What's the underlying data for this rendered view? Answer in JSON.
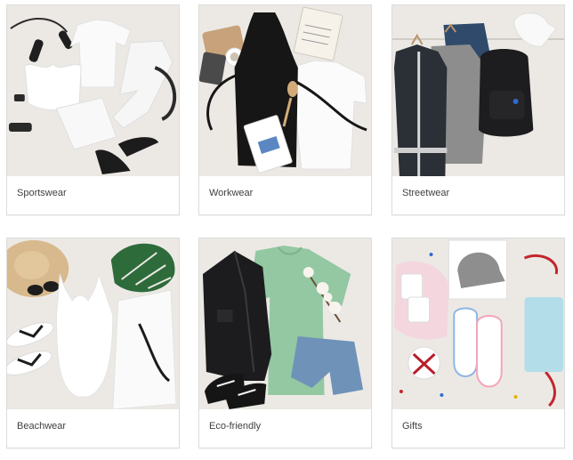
{
  "section": {
    "title": ""
  },
  "categories": [
    {
      "label": "Sportswear",
      "image": "sportswear-flatlay-image"
    },
    {
      "label": "Workwear",
      "image": "workwear-flatlay-image"
    },
    {
      "label": "Streetwear",
      "image": "streetwear-flatlay-image"
    },
    {
      "label": "Beachwear",
      "image": "beachwear-flatlay-image"
    },
    {
      "label": "Eco-friendly",
      "image": "eco-friendly-flatlay-image"
    },
    {
      "label": "Gifts",
      "image": "gifts-flatlay-image"
    }
  ],
  "colors": {
    "photo_background": "#ece9e5",
    "card_border": "#dcdcdc",
    "label_text": "#3f3f3f"
  }
}
